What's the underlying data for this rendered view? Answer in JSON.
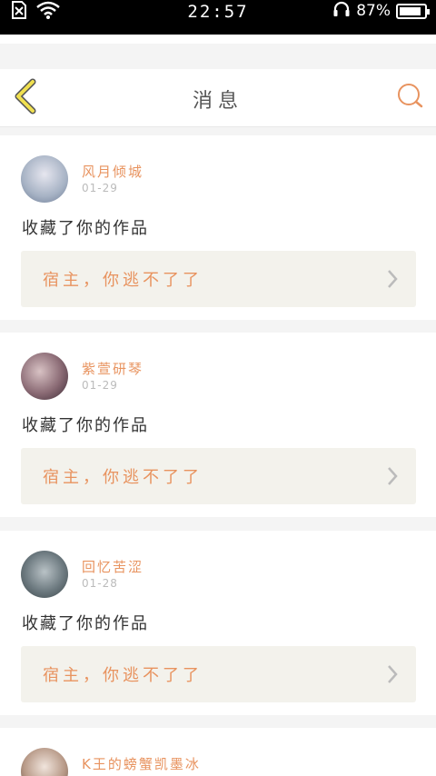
{
  "status_bar": {
    "time": "22:57",
    "battery": "87%",
    "battery_level": 0.87,
    "icons": [
      "sim-blocked-icon",
      "wifi-icon",
      "headphones-icon",
      "battery-icon"
    ]
  },
  "header": {
    "title": "消息",
    "back_icon": "chevron-left-icon",
    "search_icon": "search-icon"
  },
  "colors": {
    "accent": "#e8935f",
    "back": "#f0e050",
    "work_bg": "#f3f2ec"
  },
  "messages": [
    {
      "user": "风月倾城",
      "date": "01-29",
      "action": "收藏了你的作品",
      "work_title": "宿主，你逃不了了"
    },
    {
      "user": "紫萱研琴",
      "date": "01-29",
      "action": "收藏了你的作品",
      "work_title": "宿主，你逃不了了"
    },
    {
      "user": "回忆苦涩",
      "date": "01-28",
      "action": "收藏了你的作品",
      "work_title": "宿主，你逃不了了"
    },
    {
      "user": "K王的螃蟹凯墨冰"
    }
  ]
}
